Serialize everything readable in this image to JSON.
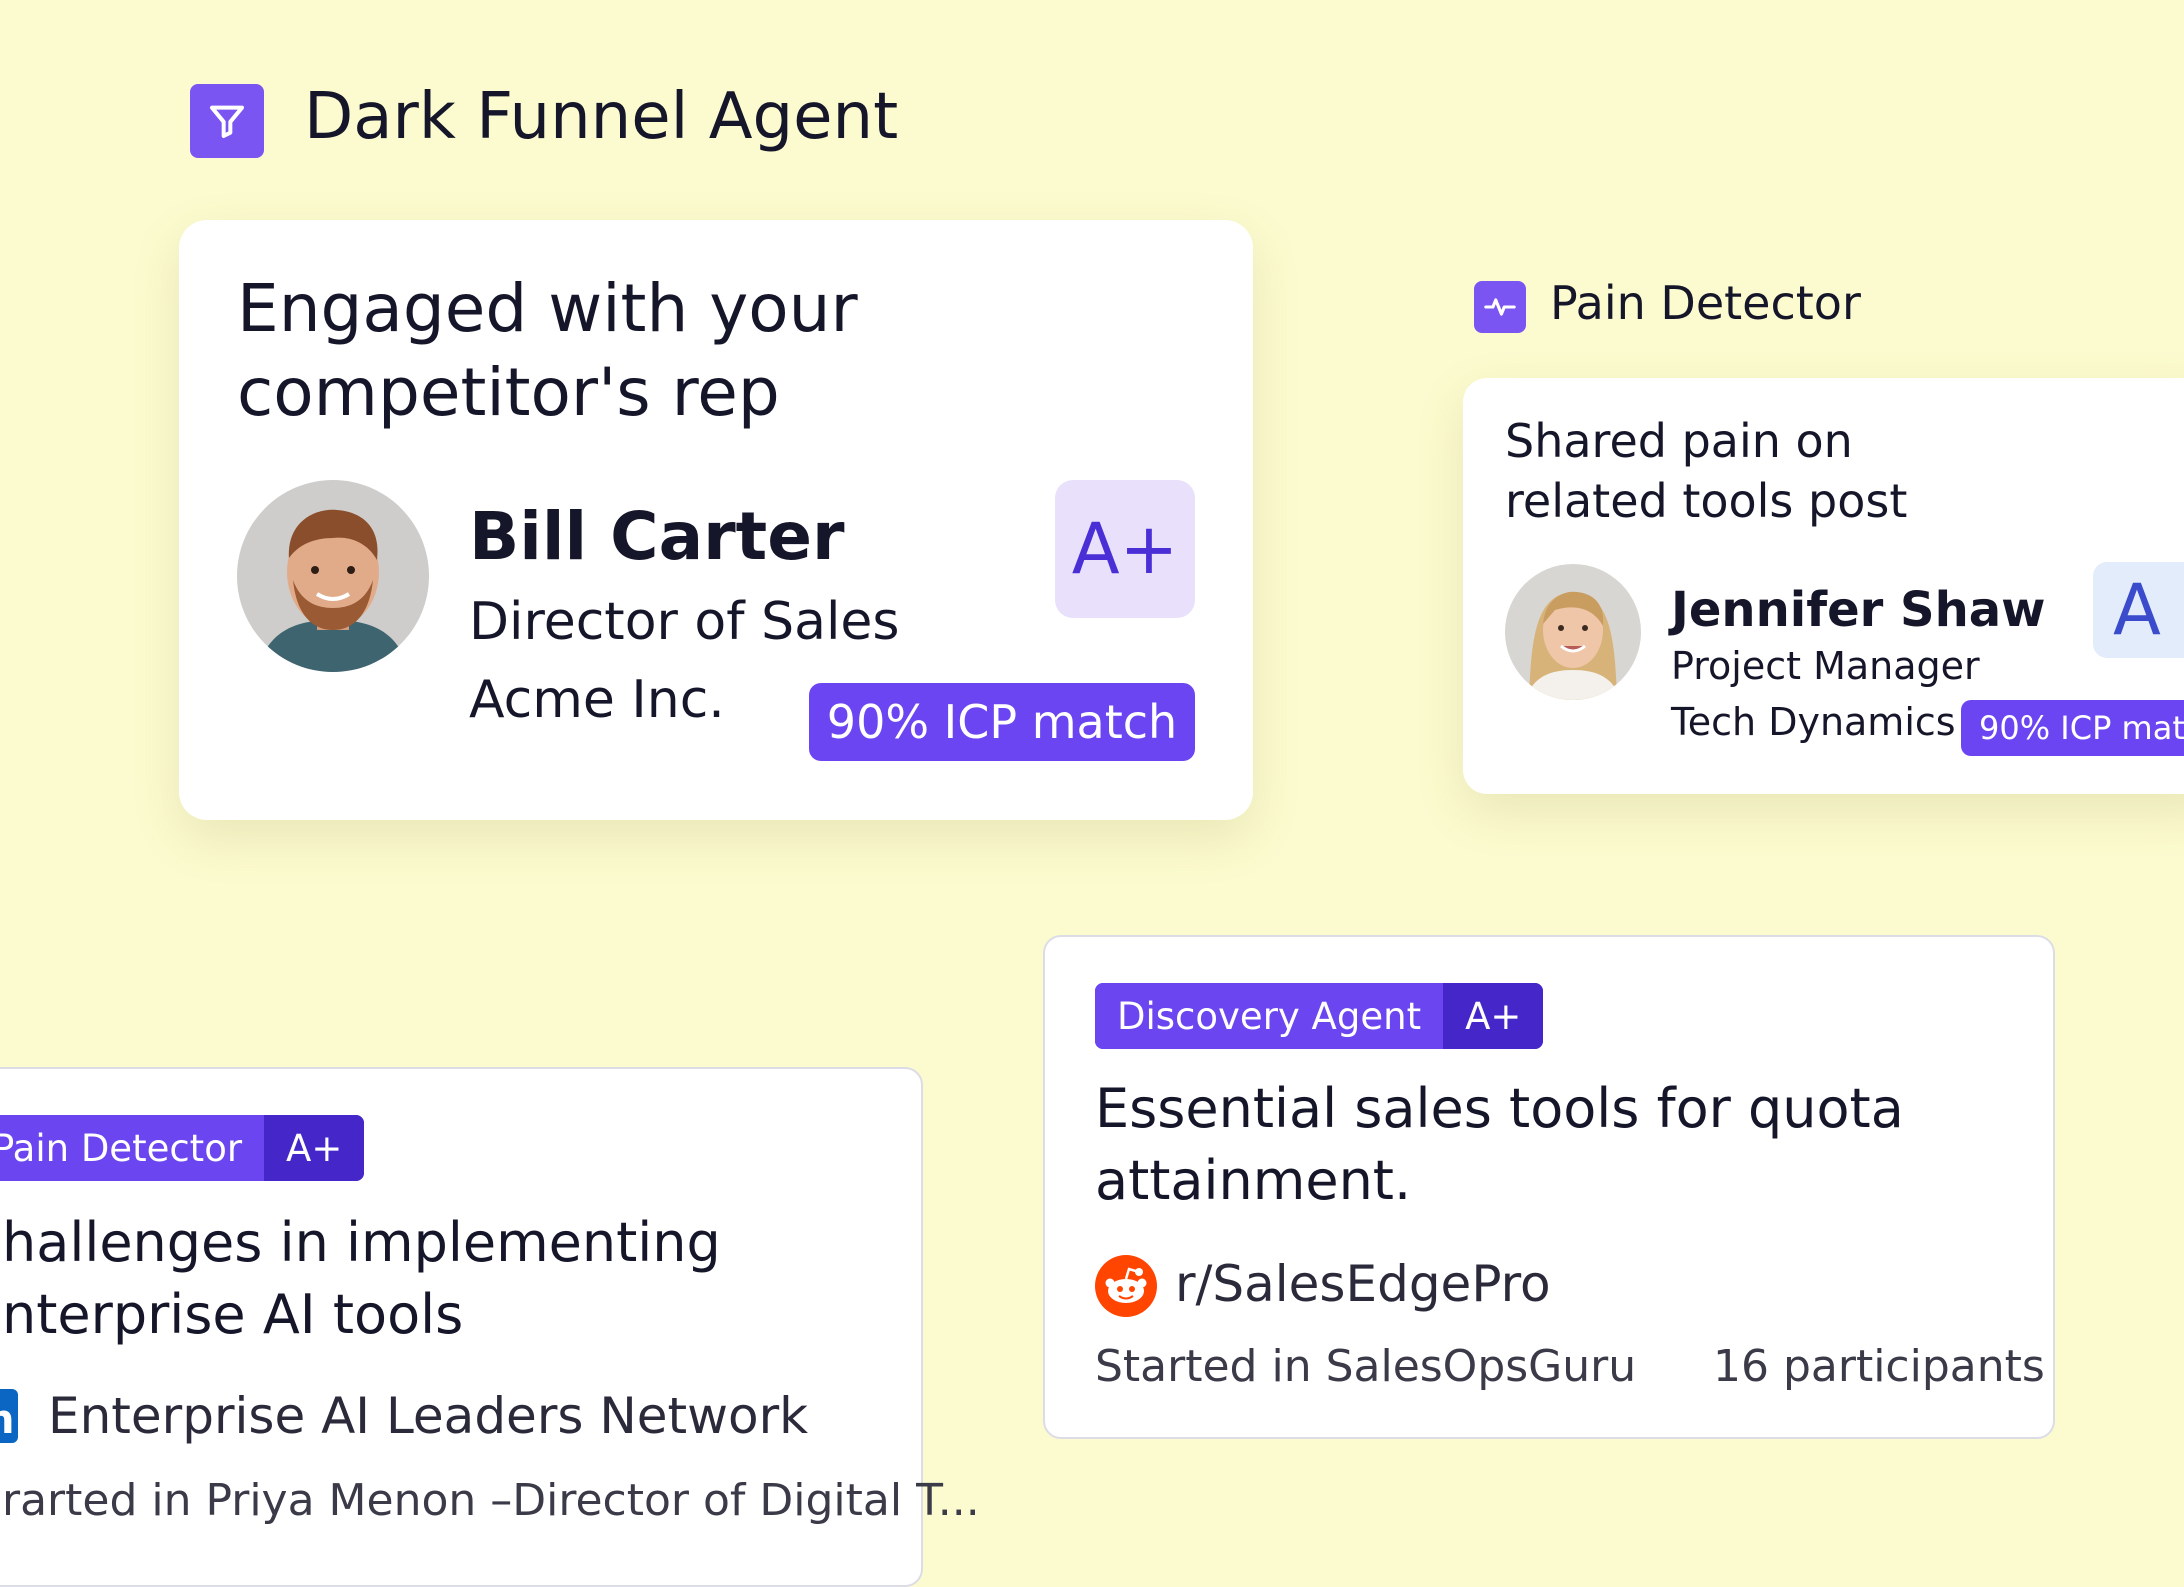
{
  "header": {
    "title": "Dark Funnel Agent",
    "icon": "funnel-icon"
  },
  "main_card": {
    "heading_line1": "Engaged with your",
    "heading_line2": "competitor's rep",
    "name": "Bill Carter",
    "role": "Director of Sales",
    "company": "Acme Inc.",
    "grade": "A+",
    "icp": "90% ICP match"
  },
  "pain_detector_section": {
    "label": "Pain Detector",
    "icon": "pulse-icon",
    "card": {
      "heading_line1": "Shared pain on",
      "heading_line2": "related tools post",
      "name": "Jennifer Shaw",
      "role": "Project Manager",
      "company": "Tech Dynamics",
      "grade": "A",
      "icp": "90% ICP matc"
    }
  },
  "discovery_card": {
    "tag_label": "Discovery Agent",
    "tag_grade": "A+",
    "title_line1": "Essential sales tools for quota",
    "title_line2": "attainment.",
    "source": "r/SalesEdgePro",
    "source_icon": "reddit-icon",
    "started": "Started in SalesOpsGuru",
    "participants": "16 participants"
  },
  "pain_card_bottom": {
    "tag_label": "Pain Detector",
    "tag_grade": "A+",
    "title_line1": "hallenges in implementing",
    "title_line2": "nterprise AI tools",
    "source": "Enterprise AI Leaders Network",
    "source_icon": "linkedin-icon",
    "started": "rarted in Priya Menon –Director of Digital T..."
  },
  "colors": {
    "accent": "#6c45f2",
    "background": "#fcfbcf",
    "reddit": "#ff4500",
    "linkedin": "#0a66c2"
  }
}
